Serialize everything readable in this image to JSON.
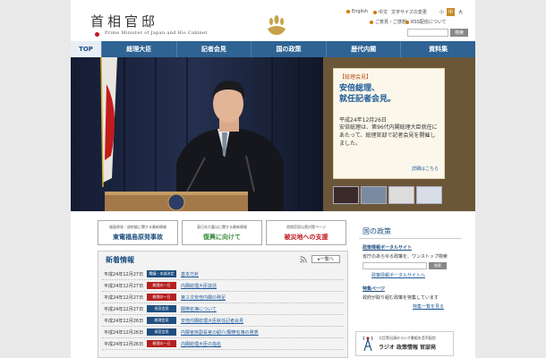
{
  "header": {
    "title": "首相官邸",
    "subtitle": "Prime Minister of Japan and His Cabinet",
    "util_links": [
      "English",
      "中文",
      "文字サイズの変更"
    ],
    "size_buttons": [
      "小",
      "中",
      "大"
    ],
    "util_links_2": [
      "ご意見・ご感想",
      "RSS配信について"
    ],
    "search_button": "検索"
  },
  "nav": {
    "items": [
      "TOP",
      "総理大臣",
      "記者会見",
      "国の政策",
      "歴代内閣",
      "資料集"
    ]
  },
  "press": {
    "tag": "【総理会見】",
    "headline_line1": "安倍総理、",
    "headline_line2": "就任記者会見。",
    "date": "平成24年12月26日",
    "body": "安倍総理は、第96代内閣総理大臣就任にあたって、総理官邸で記者会見を開催しました。",
    "link": "詳細はこちら"
  },
  "banners": [
    {
      "small": "福島原発・放射能に関する最新情報",
      "big": "東電福島原発事故",
      "color": "#1f4f80"
    },
    {
      "small": "東日本大震災に関する最新情報",
      "big": "復興に向けて",
      "color": "#3a8a3a"
    },
    {
      "small": "首相官邸災害対策ページ",
      "big": "被災地への支援",
      "color": "#c0171c"
    }
  ],
  "news": {
    "title": "新着情報",
    "more": "一覧へ",
    "items": [
      {
        "date": "平成24年12月27日",
        "badge": "閣議・本部決定",
        "badge_color": "#1f4f80",
        "text": "基本方針"
      },
      {
        "date": "平成24年12月27日",
        "badge": "総理の一日",
        "badge_color": "#b52020",
        "text": "内閣総理大臣談話"
      },
      {
        "date": "平成24年12月27日",
        "badge": "総理の一日",
        "badge_color": "#b52020",
        "text": "第２次安倍内閣の発足"
      },
      {
        "date": "平成24年12月27日",
        "badge": "長官会見",
        "badge_color": "#1f4f80",
        "text": "閣僚名簿について"
      },
      {
        "date": "平成24年12月26日",
        "badge": "総理会見",
        "badge_color": "#1f4f80",
        "text": "安倍内閣総理大臣就任記者会見"
      },
      {
        "date": "平成24年12月26日",
        "badge": "長官会見",
        "badge_color": "#1f4f80",
        "text": "内閣官房副長官の紹介/閣僚名簿の発表"
      },
      {
        "date": "平成24年12月26日",
        "badge": "総理の一日",
        "badge_color": "#b52020",
        "text": "内閣総理大臣の指名"
      }
    ]
  },
  "gov": {
    "title": "国の政策",
    "portal_title": "政策情報ポータルサイト",
    "portal_desc": "省庁のあらゆる政策を、ワンストップ検索",
    "search_button": "検索",
    "portal_link": "政策情報ポータルサイトへ",
    "feature_title": "特集ページ",
    "feature_desc": "政府が取り組む政策を特集しています",
    "feature_link": "特集一覧を見る"
  },
  "radio": {
    "small": "大臣等出演のラジオ番組を音声配信",
    "big": "ラジオ 政策情報 官邸発"
  }
}
